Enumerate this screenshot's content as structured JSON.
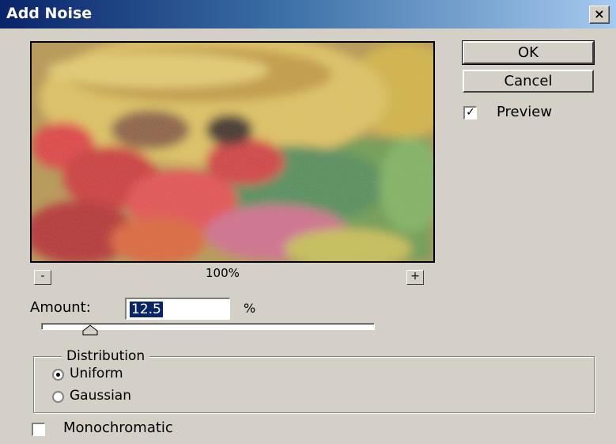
{
  "window": {
    "title": "Add Noise",
    "close_symbol": "×"
  },
  "buttons": {
    "ok": "OK",
    "cancel": "Cancel"
  },
  "preview": {
    "checked": true,
    "label": "Preview"
  },
  "zoom": {
    "minus": "-",
    "plus": "+",
    "level": "100%"
  },
  "amount": {
    "label": "Amount:",
    "value": "12.5",
    "unit": "%",
    "slider_value": 12.5,
    "slider_max": 400
  },
  "distribution": {
    "legend": "Distribution",
    "options": [
      {
        "label": "Uniform",
        "selected": true
      },
      {
        "label": "Gaussian",
        "selected": false
      }
    ]
  },
  "monochromatic": {
    "label": "Monochromatic",
    "checked": false
  },
  "icons": [
    "close-icon",
    "checkmark-icon",
    "slider-thumb-icon"
  ]
}
